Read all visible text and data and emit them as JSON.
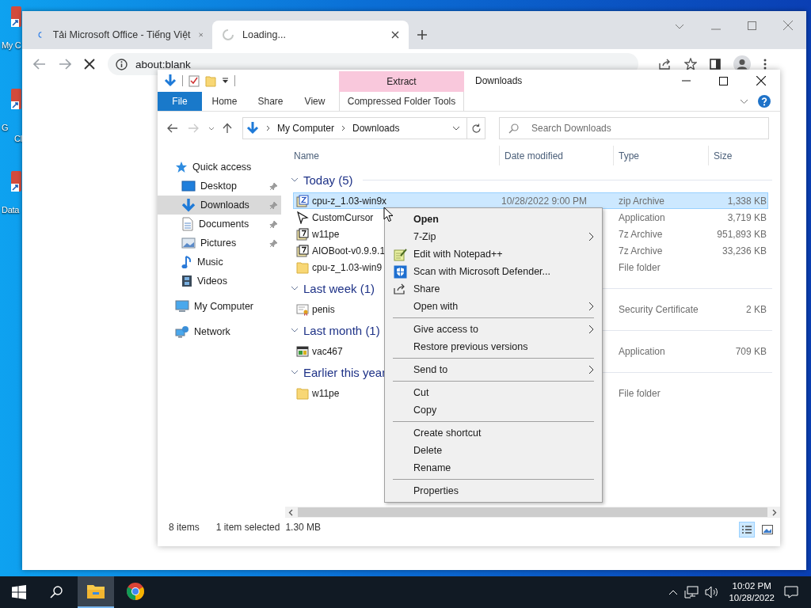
{
  "desktop_icons": [
    {
      "lines": [
        "My C"
      ]
    },
    {
      "lines": [
        "G",
        "Cl"
      ]
    },
    {
      "lines": [
        "Data"
      ]
    }
  ],
  "browser": {
    "tabs": [
      {
        "title": "Tải Microsoft Office - Tiếng Việt",
        "selected": false,
        "loading": false
      },
      {
        "title": "Loading...",
        "selected": true,
        "loading": true
      }
    ],
    "address": "about:blank"
  },
  "explorer": {
    "title": "Downloads",
    "contextual_group": "Extract",
    "ribbon_tabs": [
      {
        "label": "File",
        "kind": "file"
      },
      {
        "label": "Home",
        "kind": "tab"
      },
      {
        "label": "Share",
        "kind": "tab"
      },
      {
        "label": "View",
        "kind": "tab"
      },
      {
        "label": "Compressed Folder Tools",
        "kind": "contextual"
      }
    ],
    "breadcrumb": [
      "My Computer",
      "Downloads"
    ],
    "search": {
      "placeholder": "Search Downloads"
    },
    "nav": [
      {
        "label": "Quick access",
        "kind": "star",
        "selected": false,
        "children": [
          {
            "label": "Desktop",
            "kind": "desktop",
            "pinned": true,
            "selected": false
          },
          {
            "label": "Downloads",
            "kind": "download",
            "pinned": true,
            "selected": true
          },
          {
            "label": "Documents",
            "kind": "documents",
            "pinned": true,
            "selected": false
          },
          {
            "label": "Pictures",
            "kind": "pictures",
            "pinned": true,
            "selected": false
          },
          {
            "label": "Music",
            "kind": "music",
            "pinned": false,
            "selected": false
          },
          {
            "label": "Videos",
            "kind": "videos",
            "pinned": false,
            "selected": false
          }
        ]
      },
      {
        "label": "My Computer",
        "kind": "computer",
        "selected": false
      },
      {
        "label": "Network",
        "kind": "network",
        "selected": false
      }
    ],
    "columns": [
      "Name",
      "Date modified",
      "Type",
      "Size"
    ],
    "groups": [
      {
        "label": "Today (5)",
        "expanded": true,
        "files": [
          {
            "name": "cpu-z_1.03-win9x",
            "date": "10/28/2022 9:00 PM",
            "type": "zip Archive",
            "size": "1,338 KB",
            "kind": "zip",
            "selected": true
          },
          {
            "name": "CustomCursor",
            "type": "Application",
            "size": "3,719 KB",
            "kind": "cursor",
            "selected": false
          },
          {
            "name": "w11pe",
            "type": "7z Archive",
            "size": "951,893 KB",
            "kind": "archive",
            "selected": false
          },
          {
            "name": "AIOBoot-v0.9.9.1",
            "type": "7z Archive",
            "size": "33,236 KB",
            "kind": "archive",
            "selected": false
          },
          {
            "name": "cpu-z_1.03-win9",
            "type": "File folder",
            "kind": "folder",
            "selected": false
          }
        ]
      },
      {
        "label": "Last week (1)",
        "expanded": true,
        "files": [
          {
            "name": "penis",
            "type": "Security Certificate",
            "size": "2 KB",
            "kind": "cert",
            "selected": false
          }
        ]
      },
      {
        "label": "Last month (1)",
        "expanded": true,
        "files": [
          {
            "name": "vac467",
            "type": "Application",
            "size": "709 KB",
            "kind": "app",
            "selected": false
          }
        ]
      },
      {
        "label": "Earlier this year",
        "expanded": true,
        "files": [
          {
            "name": "w11pe",
            "type": "File folder",
            "kind": "folder",
            "selected": false
          }
        ]
      }
    ],
    "status": {
      "count": "8 items",
      "selection": "1 item selected",
      "size": "1.30 MB"
    },
    "context_menu": {
      "sections": [
        [
          {
            "label": "Open",
            "bold": true,
            "submenu": false
          },
          {
            "label": "7-Zip",
            "bold": false,
            "submenu": true
          },
          {
            "label": "Edit with Notepad++",
            "bold": false,
            "submenu": false,
            "kind": "notepad"
          },
          {
            "label": "Scan with Microsoft Defender...",
            "bold": false,
            "submenu": false,
            "kind": "shield"
          },
          {
            "label": "Share",
            "bold": false,
            "submenu": false,
            "kind": "share"
          },
          {
            "label": "Open with",
            "bold": false,
            "submenu": true
          }
        ],
        [
          {
            "label": "Give access to",
            "bold": false,
            "submenu": true
          },
          {
            "label": "Restore previous versions",
            "bold": false,
            "submenu": false
          }
        ],
        [
          {
            "label": "Send to",
            "bold": false,
            "submenu": true
          }
        ],
        [
          {
            "label": "Cut",
            "bold": false,
            "submenu": false
          },
          {
            "label": "Copy",
            "bold": false,
            "submenu": false
          }
        ],
        [
          {
            "label": "Create shortcut",
            "bold": false,
            "submenu": false
          },
          {
            "label": "Delete",
            "bold": false,
            "submenu": false
          },
          {
            "label": "Rename",
            "bold": false,
            "submenu": false
          }
        ],
        [
          {
            "label": "Properties",
            "bold": false,
            "submenu": false
          }
        ]
      ]
    }
  },
  "taskbar": {
    "apps": [
      {
        "kind": "explorer",
        "active": true
      },
      {
        "kind": "chrome",
        "active": false
      }
    ],
    "time": "10:02 PM",
    "date": "10/28/2022"
  }
}
